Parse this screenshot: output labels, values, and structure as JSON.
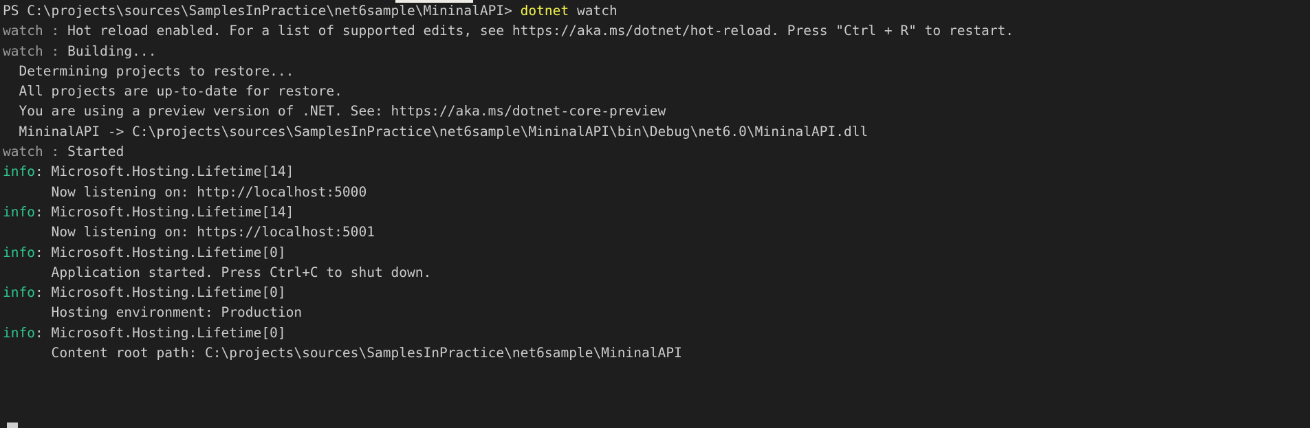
{
  "terminal": {
    "background_color": "#1e1e1e",
    "default_text_color": "#cccccc",
    "dim_text_color": "#9b9b9b",
    "yellow_text_color": "#f2f24c",
    "green_text_color": "#2fc58f",
    "cursor_color": "#cfcfcf",
    "tab_indicator_color": "#eeebe6",
    "lines": [
      {
        "name": "prompt-line",
        "segments": [
          {
            "text": "PS C:\\projects\\sources\\SamplesInPractice\\net6sample\\MininalAPI> ",
            "color": "default"
          },
          {
            "text": "dotnet",
            "color": "yellow"
          },
          {
            "text": " watch",
            "color": "default"
          }
        ]
      },
      {
        "name": "watch-hot-reload-line",
        "segments": [
          {
            "text": "watch : ",
            "color": "dim"
          },
          {
            "text": "Hot reload enabled. For a list of supported edits, see https://aka.ms/dotnet/hot-reload. Press \"Ctrl + R\" to restart.",
            "color": "default"
          }
        ]
      },
      {
        "name": "watch-building-line",
        "segments": [
          {
            "text": "watch : ",
            "color": "dim"
          },
          {
            "text": "Building...",
            "color": "default"
          }
        ]
      },
      {
        "name": "determining-projects-line",
        "segments": [
          {
            "text": "  Determining projects to restore...",
            "color": "default"
          }
        ]
      },
      {
        "name": "projects-up-to-date-line",
        "segments": [
          {
            "text": "  All projects are up-to-date for restore.",
            "color": "default"
          }
        ]
      },
      {
        "name": "preview-version-line",
        "segments": [
          {
            "text": "  You are using a preview version of .NET. See: https://aka.ms/dotnet-core-preview",
            "color": "default"
          }
        ]
      },
      {
        "name": "build-output-dll-line",
        "segments": [
          {
            "text": "  MininalAPI -> C:\\projects\\sources\\SamplesInPractice\\net6sample\\MininalAPI\\bin\\Debug\\net6.0\\MininalAPI.dll",
            "color": "default"
          }
        ]
      },
      {
        "name": "watch-started-line",
        "segments": [
          {
            "text": "watch : ",
            "color": "dim"
          },
          {
            "text": "Started",
            "color": "default"
          }
        ]
      },
      {
        "name": "info-lifetime-14-http-line",
        "segments": [
          {
            "text": "info",
            "color": "green"
          },
          {
            "text": ": Microsoft.Hosting.Lifetime[14]",
            "color": "default"
          }
        ]
      },
      {
        "name": "listening-http-line",
        "segments": [
          {
            "text": "      Now listening on: http://localhost:5000",
            "color": "default"
          }
        ]
      },
      {
        "name": "info-lifetime-14-https-line",
        "segments": [
          {
            "text": "info",
            "color": "green"
          },
          {
            "text": ": Microsoft.Hosting.Lifetime[14]",
            "color": "default"
          }
        ]
      },
      {
        "name": "listening-https-line",
        "segments": [
          {
            "text": "      Now listening on: https://localhost:5001",
            "color": "default"
          }
        ]
      },
      {
        "name": "info-lifetime-0-started-line",
        "segments": [
          {
            "text": "info",
            "color": "green"
          },
          {
            "text": ": Microsoft.Hosting.Lifetime[0]",
            "color": "default"
          }
        ]
      },
      {
        "name": "application-started-line",
        "segments": [
          {
            "text": "      Application started. Press Ctrl+C to shut down.",
            "color": "default"
          }
        ]
      },
      {
        "name": "info-lifetime-0-env-line",
        "segments": [
          {
            "text": "info",
            "color": "green"
          },
          {
            "text": ": Microsoft.Hosting.Lifetime[0]",
            "color": "default"
          }
        ]
      },
      {
        "name": "hosting-environment-line",
        "segments": [
          {
            "text": "      Hosting environment: Production",
            "color": "default"
          }
        ]
      },
      {
        "name": "info-lifetime-0-contentroot-line",
        "segments": [
          {
            "text": "info",
            "color": "green"
          },
          {
            "text": ": Microsoft.Hosting.Lifetime[0]",
            "color": "default"
          }
        ]
      },
      {
        "name": "content-root-path-line",
        "segments": [
          {
            "text": "      Content root path: C:\\projects\\sources\\SamplesInPractice\\net6sample\\MininalAPI",
            "color": "default"
          }
        ]
      }
    ]
  }
}
